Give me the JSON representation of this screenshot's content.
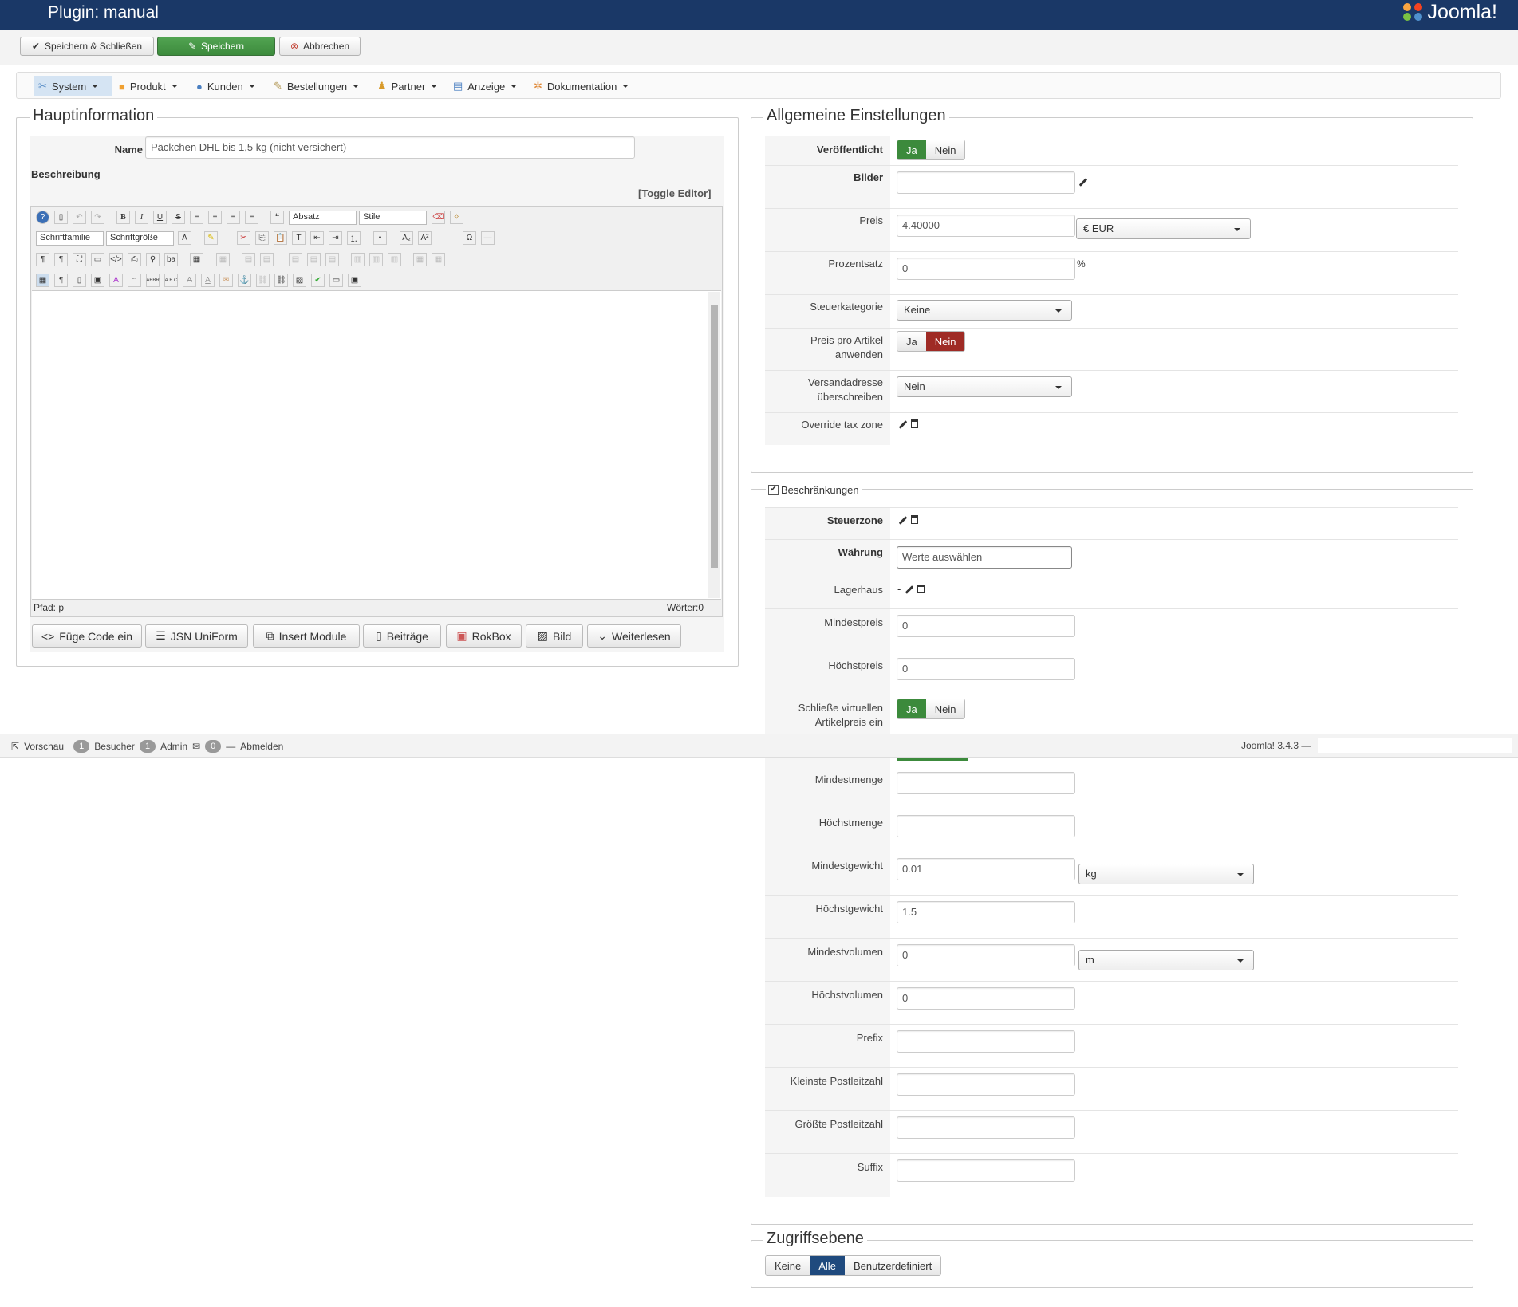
{
  "header": {
    "title": "Plugin: manual",
    "logo_text": "Joomla!"
  },
  "toolbar": {
    "save_close": "Speichern & Schließen",
    "save": "Speichern",
    "cancel": "Abbrechen"
  },
  "nav": {
    "items": [
      "System",
      "Produkt",
      "Kunden",
      "Bestellungen",
      "Partner",
      "Anzeige",
      "Dokumentation"
    ]
  },
  "main_info": {
    "legend": "Hauptinformation",
    "name_label": "Name",
    "name_value": "Päckchen DHL bis 1,5 kg (nicht versichert)",
    "description_label": "Beschreibung",
    "toggle_editor": "[Toggle Editor]",
    "editor": {
      "format_select": "Absatz",
      "style_select": "Stile",
      "font_family": "Schriftfamilie",
      "font_size": "Schriftgröße",
      "path_label": "Pfad:",
      "path_value": "p",
      "word_count": "Wörter:0"
    },
    "buttons": [
      "Füge Code ein",
      "JSN UniForm",
      "Insert Module",
      "Beiträge",
      "RokBox",
      "Bild",
      "Weiterlesen"
    ]
  },
  "general": {
    "legend": "Allgemeine Einstellungen",
    "published_label": "Veröffentlicht",
    "yes": "Ja",
    "no": "Nein",
    "images_label": "Bilder",
    "price_label": "Preis",
    "price_value": "4.40000",
    "currency": "€ EUR",
    "percent_label": "Prozentsatz",
    "percent_value": "0",
    "percent_unit": "%",
    "tax_category_label": "Steuerkategorie",
    "tax_category_value": "Keine",
    "price_per_item_label_1": "Preis pro Artikel",
    "price_per_item_label_2": "anwenden",
    "override_address_label_1": "Versandadresse",
    "override_address_label_2": "überschreiben",
    "override_address_value": "Nein",
    "override_tax_zone_label": "Override tax zone"
  },
  "restrictions": {
    "legend": "Beschränkungen",
    "tax_zone_label": "Steuerzone",
    "currency_label": "Währung",
    "currency_placeholder": "Werte auswählen",
    "warehouse_label": "Lagerhaus",
    "warehouse_value": "-",
    "min_price_label": "Mindestpreis",
    "min_price_value": "0",
    "max_price_label": "Höchstpreis",
    "max_price_value": "0",
    "exclude_virtual_label_1": "Schließe virtuellen",
    "exclude_virtual_label_2": "Artikelpreis ein",
    "min_qty_label": "Mindestmenge",
    "max_qty_label": "Höchstmenge",
    "min_weight_label": "Mindestgewicht",
    "min_weight_value": "0.01",
    "weight_unit": "kg",
    "max_weight_label": "Höchstgewicht",
    "max_weight_value": "1.5",
    "min_volume_label": "Mindestvolumen",
    "min_volume_value": "0",
    "volume_unit": "m",
    "max_volume_label": "Höchstvolumen",
    "max_volume_value": "0",
    "prefix_label": "Prefix",
    "min_zip_label": "Kleinste Postleitzahl",
    "max_zip_label": "Größte Postleitzahl",
    "suffix_label": "Suffix"
  },
  "access": {
    "legend": "Zugriffsebene",
    "options": [
      "Keine",
      "Alle",
      "Benutzerdefiniert"
    ],
    "selected": "Alle"
  },
  "statusbar": {
    "preview": "Vorschau",
    "visitors_count": "1",
    "visitors": "Besucher",
    "admin_count": "1",
    "admin": "Admin",
    "messages_count": "0",
    "logout": "Abmelden",
    "version": "Joomla! 3.4.3 —"
  },
  "colors": {
    "header_bg": "#1a3867",
    "green": "#3c8a3c",
    "red": "#9f2b25",
    "blue": "#1f4a7e"
  }
}
